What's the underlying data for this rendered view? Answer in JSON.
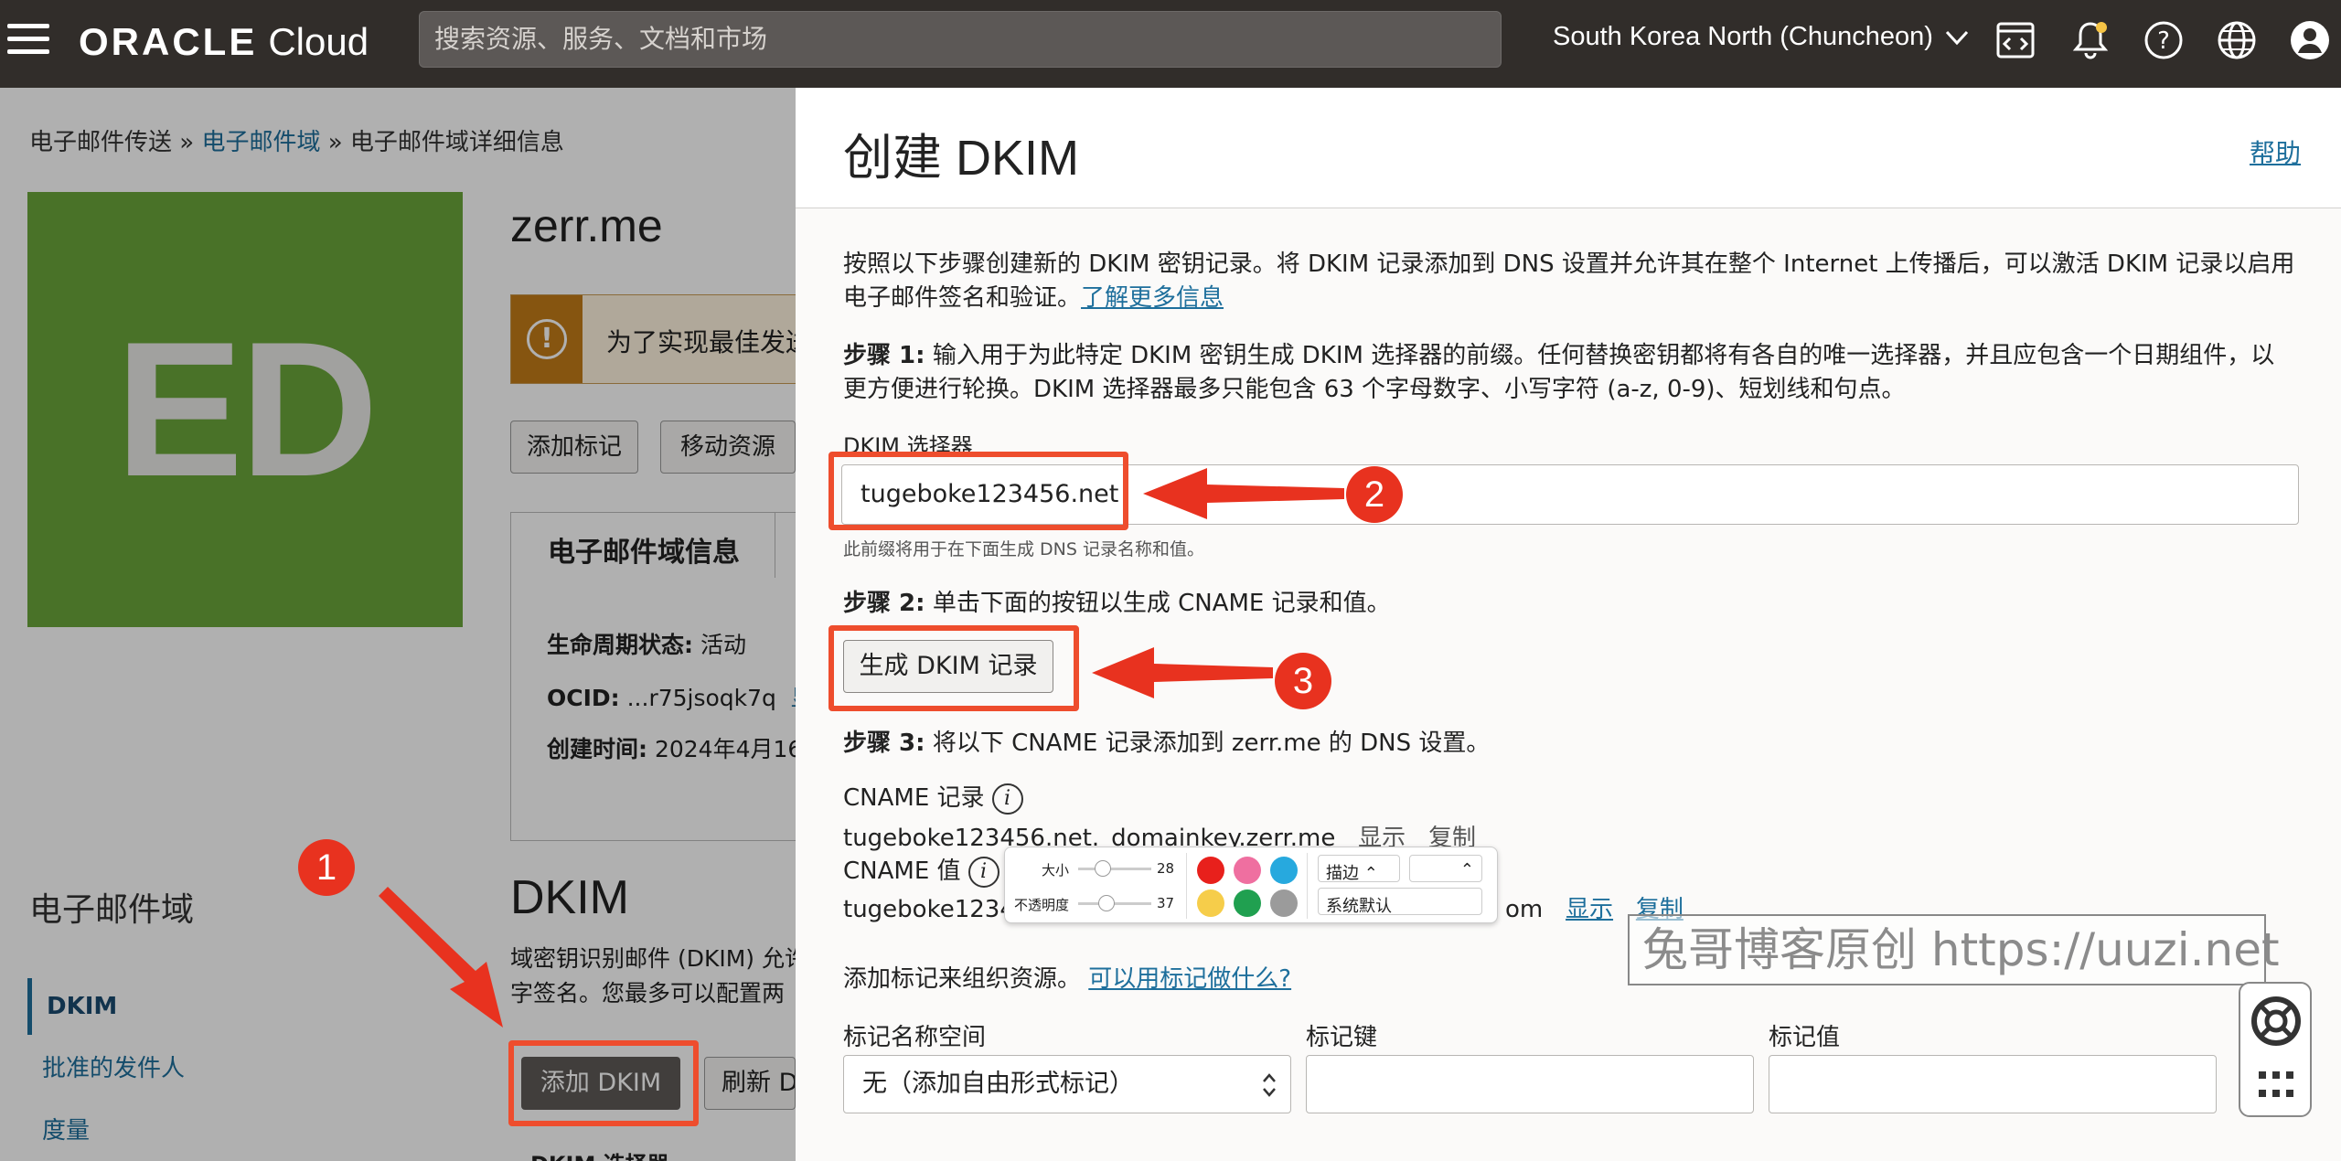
{
  "topbar": {
    "logo_brand": "ORACLE",
    "logo_product": "Cloud",
    "search_placeholder": "搜索资源、服务、文档和市场",
    "region": "South Korea North (Chuncheon)"
  },
  "page": {
    "breadcrumb": [
      "电子邮件传送",
      "电子邮件域",
      "电子邮件域详细信息"
    ],
    "avatar_initials": "ED",
    "domain_name": "zerr.me",
    "warning_text": "为了实现最佳发送",
    "buttons": [
      "添加标记",
      "移动资源"
    ],
    "tab_label": "电子邮件域信息",
    "info": {
      "lifecycle_label": "生命周期状态:",
      "lifecycle_value": "活动",
      "ocid_label": "OCID:",
      "ocid_value": "...r75jsoqk7q",
      "ocid_show": "显",
      "created_label": "创建时间:",
      "created_value": "2024年4月16"
    },
    "section_title": "电子邮件域",
    "nav": [
      "DKIM",
      "批准的发件人",
      "度量"
    ],
    "dkim_heading": "DKIM",
    "dkim_desc_1": "域密钥识别邮件 (DKIM) 允许",
    "dkim_desc_2": "字签名。您最多可以配置两",
    "add_dkim": "添加 DKIM",
    "refresh": "刷新 D",
    "selector_col": "DKIM 选择器"
  },
  "drawer": {
    "title": "创建 DKIM",
    "help": "帮助",
    "intro_1": "按照以下步骤创建新的 DKIM 密钥记录。将 DKIM 记录添加到 DNS 设置并允许其在整个 Internet 上传播后，可以激活 DKIM 记录以启用",
    "intro_2": "电子邮件签名和验证。",
    "learn_more": "了解更多信息",
    "step1_label": "步骤 1:",
    "step1_text": "输入用于为此特定 DKIM 密钥生成 DKIM 选择器的前缀。任何替换密钥都将有各自的唯一选择器，并且应包含一个日期组件，以",
    "step1_text_2": "更方便进行轮换。DKIM 选择器最多只能包含 63 个字母数字、小写字符 (a-z, 0-9)、短划线和句点。",
    "selector_label": "DKIM 选择器",
    "selector_value": "tugeboke123456.net",
    "selector_hint": "此前缀将用于在下面生成 DNS 记录名称和值。",
    "step2_label": "步骤 2:",
    "step2_text": "单击下面的按钮以生成 CNAME 记录和值。",
    "generate_button": "生成 DKIM 记录",
    "step3_label": "步骤 3:",
    "step3_text": "将以下 CNAME 记录添加到 zerr.me 的 DNS 设置。",
    "cname_record_label": "CNAME 记录",
    "cname_record_value": "tugeboke123456.net._domainkey.zerr.me",
    "show": "显示",
    "copy": "复制",
    "cname_value_label": "CNAME 值",
    "cname_value_value": "tugeboke12345",
    "cname_value_suffix": "om",
    "tags_intro": "添加标记来组织资源。",
    "tags_link": "可以用标记做什么?",
    "tag_ns_label": "标记名称空间",
    "tag_ns_value": "无（添加自由形式标记）",
    "tag_key_label": "标记键",
    "tag_value_label": "标记值"
  },
  "annotation_toolbar": {
    "size_label": "大小",
    "size_value": "28",
    "opacity_label": "不透明度",
    "opacity_value": "37",
    "stroke": "描边",
    "system_default": "系统默认",
    "colors": [
      "#e8201c",
      "#ef6fa0",
      "#27a9de",
      "#f6cd4a",
      "#20a050",
      "#9b9b9b"
    ]
  },
  "callouts": [
    "1",
    "2",
    "3"
  ],
  "watermark": "兔哥博客原创 https://uuzi.net",
  "colors": {
    "topbar": "#312d2a",
    "link": "#1e6f9c",
    "highlight": "#ee4d2d",
    "avatar": "#6aa53a"
  }
}
